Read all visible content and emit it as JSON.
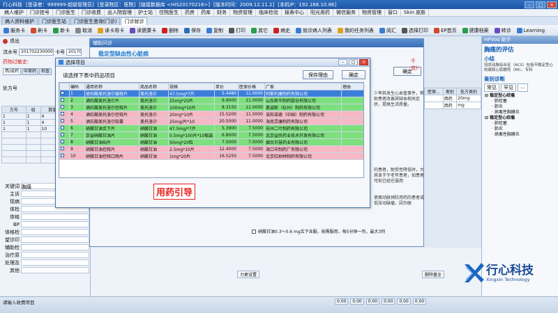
{
  "window": {
    "title_items": [
      "行心科技",
      "[登录者：999999-超级管理员]",
      "[登录院区：医院]",
      "[链接数据库 <HIS20170216>]",
      "[版本时间：2009.12.11.2]",
      "[本机IP：192.168.10.86]"
    ],
    "controls": [
      "–",
      "□",
      "×"
    ]
  },
  "menu": [
    "病人维护",
    "门诊挂号",
    "门诊医生",
    "门诊收费",
    "出入院管理",
    "护士站",
    "住院医生",
    "药房",
    "药库",
    "财务",
    "物资管理",
    "临床检验",
    "报表中心",
    "阳光用药",
    "微信服务",
    "物资管理",
    "窗口",
    "Skin 皮肤"
  ],
  "tabs": [
    {
      "label": "病人资料维护"
    },
    {
      "label": "门诊医生站"
    },
    {
      "label": "门诊医生查询(门诊)"
    },
    {
      "label": "门诊就诊"
    }
  ],
  "toolbar": [
    "服务卡",
    "刷卡",
    "新卡",
    "取消",
    "读卡用卡",
    "读健康卡",
    "删除",
    "保存",
    "复制",
    "打印",
    "其它",
    "病史",
    "就诊病人列表",
    "我的任务列表",
    "阅汇",
    "选择打印",
    "EP首页",
    "健康档案",
    "转诊",
    "Learning"
  ],
  "subbar": {
    "back": "退出"
  },
  "left": {
    "serial_label": "流水号",
    "serial_value": "2017022300001",
    "card_label": "卡号",
    "card_value": "2017022",
    "allergy_label": "药物过敏史:",
    "tabs": [
      "西/成药",
      "中草药",
      "检查"
    ],
    "rx_label": "处方号",
    "grid_headers": [
      "方号",
      "组",
      "数量",
      "单位"
    ],
    "grid_rows": [
      [
        "1",
        "1",
        "4",
        ""
      ],
      [
        "1",
        "1",
        "4",
        ""
      ],
      [
        "1",
        "1",
        "10",
        ""
      ]
    ],
    "notes": [
      "关键词",
      "主诉",
      "现病",
      "体检",
      "体格",
      "BP",
      "体格检",
      "望诊印",
      "辅助检",
      "治疗原",
      "处理及",
      "其他"
    ],
    "notes_value": "胸痛",
    "bp_parts": [
      "T",
      "P",
      "R",
      "BP"
    ]
  },
  "assist": {
    "title": "辅助问诊",
    "heading": "稳定型缺血性心脏病",
    "confirm": "确定",
    "side1": "少率其发生心血管事件，帮助患者改善其缺血相关症状，提高生活质量。",
    "side2": "的患者，耐受性降低时，大其显于于老年患者，如患者可前已经在服用",
    "side3": "使面动脉预防用药的患者或低张动脉瘤，因为联",
    "bottom": "硝酸甘油0.3～0.6 mg舌下含服，按需服用，每5分钟一剂，最大3剂",
    "partial_label": "千克):",
    "midbottom_btns": [
      "力更设置",
      "删除量全"
    ]
  },
  "dialog": {
    "title": "选择项目",
    "prompt": "请选择下表中药品项目",
    "save_reason": "保存理由",
    "ok": "确定",
    "headers": [
      "",
      "编码",
      "通用名称",
      "商品名称",
      "规格",
      "单价",
      "医保价格",
      "厂家",
      "理由"
    ],
    "rows": [
      {
        "style": "sel",
        "code": "1",
        "generic": "琥珀酸美托洛尔缓释片",
        "brand": "美托洛尔",
        "spec": "47.5mg*7片",
        "price": "5.4480",
        "ins": "11.0000",
        "maker": "阿斯利康制药有限公司"
      },
      {
        "style": "g",
        "code": "2",
        "generic": "酒石酸美托洛尔片",
        "brand": "美托洛尔",
        "spec": "25mg*20片",
        "price": "6.9000",
        "ins": "11.0000",
        "maker": "山东新华制药股份有限公司"
      },
      {
        "style": "g",
        "code": "3",
        "generic": "酒石酸美托洛尔控释片",
        "brand": "美托洛尔",
        "spec": "100mg*10片",
        "price": "8.3150",
        "ins": "11.0000",
        "maker": "惠诚新（杭州）制药有限公司"
      },
      {
        "style": "p",
        "code": "4",
        "generic": "酒石酸美托洛尔控释片",
        "brand": "美托洛尔",
        "spec": "20mg*10片",
        "price": "15.5200",
        "ins": "11.0000",
        "maker": "诺和诺德（中国）制药有限公司"
      },
      {
        "style": "p",
        "code": "5",
        "generic": "酒石酸美托洛尔胶囊",
        "brand": "美托洛尔",
        "spec": "25mg/片*10",
        "price": "20.5000",
        "ins": "11.0000",
        "maker": "海南灵康制药有限公司"
      },
      {
        "style": "g",
        "code": "6",
        "generic": "硝酸甘油舌下片",
        "brand": "硝酸甘油",
        "spec": "47.5mg/*7片",
        "price": "5.3900",
        "ins": "7.5000",
        "maker": "苏州二叶制药有限公司"
      },
      {
        "style": "g",
        "code": "7",
        "generic": "京益硝酸甘油片",
        "brand": "硝酸甘油",
        "spec": "0.5mg*100片*10瓶装",
        "price": "6.8000",
        "ins": "7.5000",
        "maker": "北京益民药业技术开发有限公司"
      },
      {
        "style": "g",
        "code": "8",
        "generic": "硝酸甘油贴片",
        "brand": "硝酸甘油",
        "spec": "50mg*20粒",
        "price": "7.5000",
        "ins": "7.5000",
        "maker": "烟台只慧药业有限公司"
      },
      {
        "style": "p",
        "code": "9",
        "generic": "硝酸甘油控释片",
        "brand": "硝酸甘油",
        "spec": "2.5mg*10片",
        "price": "12.4000",
        "ins": "7.5000",
        "maker": "海口市制药厂有限公司"
      },
      {
        "style": "p",
        "code": "10",
        "generic": "硝酸甘油控释口颊片",
        "brand": "硝酸甘油",
        "spec": "1mg*20片",
        "price": "16.5250",
        "ins": "7.5000",
        "maker": "北京红树林制药有限公司"
      }
    ],
    "guide": "用药引导"
  },
  "rightpanel": {
    "title": "HPVod 助手",
    "heading": "胸痛的评估",
    "subheading": "小结",
    "summary": "冠状动脉综合征（ACS）包括不稳定型心绞痛和心肌梗死（MI）。专科",
    "section": "鉴别诊断",
    "tabs": [
      "常见",
      "罕见",
      "..."
    ],
    "tree": [
      {
        "level": 1,
        "text": "稳定型心绞痛"
      },
      {
        "level": 2,
        "text": "肺栓塞"
      },
      {
        "level": 2,
        "text": "肺炎"
      },
      {
        "level": 2,
        "text": "病毒性胸膜炎"
      },
      {
        "level": 1,
        "text": "稳定型心绞痛"
      },
      {
        "level": 2,
        "text": "肺栓塞"
      },
      {
        "level": 2,
        "text": "肺炎"
      },
      {
        "level": 2,
        "text": "病毒性胸膜炎"
      }
    ]
  },
  "rightgrid": {
    "headers": [
      "类别",
      "处方类别"
    ],
    "col2": "医保...",
    "rows": [
      [
        "西药",
        "20mg"
      ],
      [
        "西药",
        "mg"
      ]
    ]
  },
  "status": {
    "text": "请输入收费项目",
    "cells": [
      "0.00",
      "0.00",
      "0.00",
      "0.00",
      "0.00",
      "0.00"
    ]
  },
  "logo": {
    "cn": "行心科技",
    "en": "Xingxin Technology"
  }
}
